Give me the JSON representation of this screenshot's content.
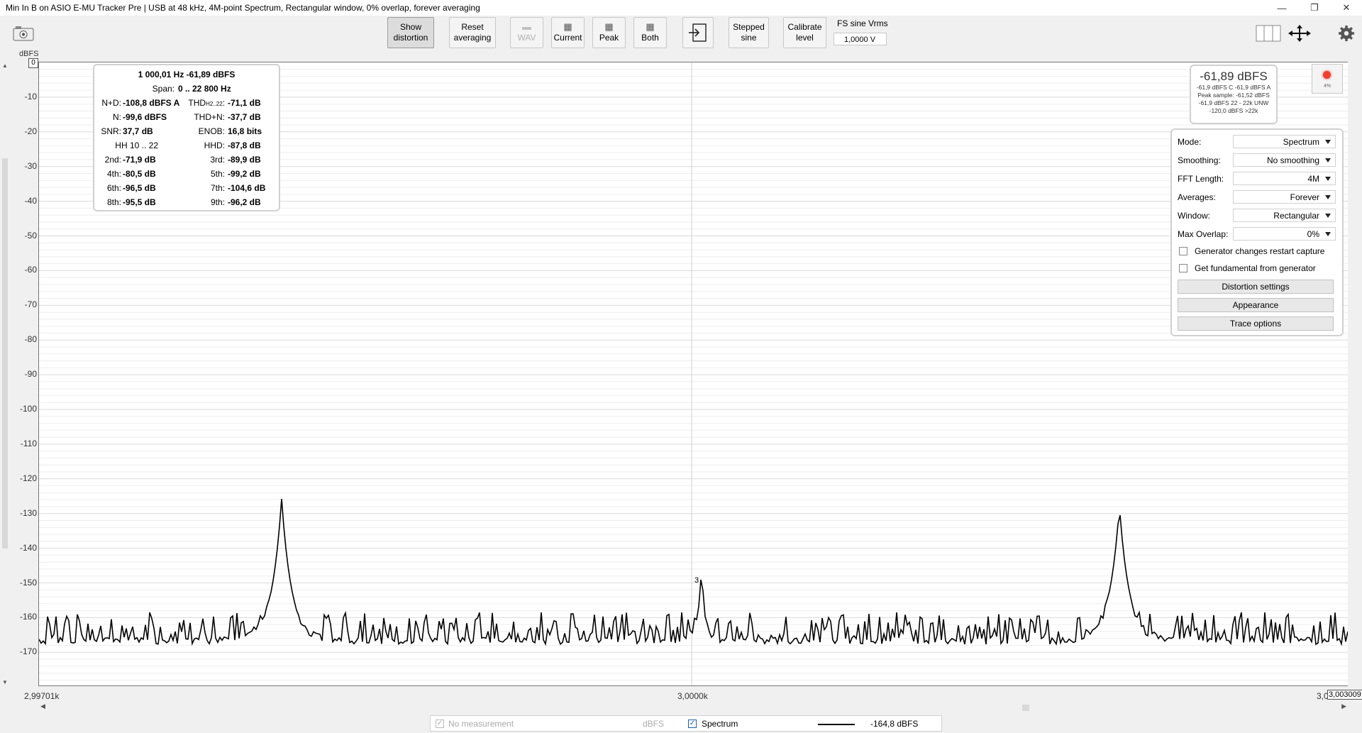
{
  "window": {
    "title": "Min In B on ASIO E-MU Tracker Pre | USB at 48 kHz, 4M-point Spectrum, Rectangular window, 0% overlap, forever averaging",
    "min_icon": "—",
    "restore_icon": "❐",
    "close_icon": "✕"
  },
  "toolbar": {
    "show_distortion": [
      "Show",
      "distortion"
    ],
    "reset_averaging": [
      "Reset",
      "averaging"
    ],
    "wav": "WAV",
    "current": "Current",
    "peak": "Peak",
    "both": "Both",
    "stepped_sine": [
      "Stepped",
      "sine"
    ],
    "calibrate_level": [
      "Calibrate",
      "level"
    ],
    "fs_label": "FS sine Vrms",
    "fs_value": "1,0000 V"
  },
  "graph": {
    "y_unit": "dBFS",
    "y_top_box": "0",
    "y_ticks": [
      "-10",
      "-20",
      "-30",
      "-40",
      "-50",
      "-60",
      "-70",
      "-80",
      "-90",
      "-100",
      "-110",
      "-120",
      "-130",
      "-140",
      "-150",
      "-160",
      "-170"
    ],
    "x_ticks": [
      "2,99701k",
      "3,0000k",
      "3,0"
    ],
    "x_cursor_box": "3,003009",
    "peak_marker": "3"
  },
  "info": {
    "header": "1 000,01 Hz  -61,89 dBFS",
    "span_label": "Span:",
    "span_value": "0 .. 22 800 Hz",
    "nd_label": "N+D:",
    "nd_value": "-108,8 dBFS A",
    "thd_label": "THD",
    "thd_sub": "H2..22",
    "thd_colon": ":",
    "thd_value": "-71,1 dB",
    "n_label": "N:",
    "n_value": "-99,6 dBFS",
    "thdn_label": "THD+N:",
    "thdn_value": "-37,7 dB",
    "snr_label": "SNR:",
    "snr_value": "37,7 dB",
    "enob_label": "ENOB:",
    "enob_value": "16,8 bits",
    "hh_label": "HH 10 .. 22",
    "hhd_label": "HHD:",
    "hhd_value": "-87,8 dB",
    "h2_label": "2nd:",
    "h2_value": "-71,9 dB",
    "h3_label": "3rd:",
    "h3_value": "-89,9 dB",
    "h4_label": "4th:",
    "h4_value": "-80,5 dB",
    "h5_label": "5th:",
    "h5_value": "-99,2 dB",
    "h6_label": "6th:",
    "h6_value": "-96,5 dB",
    "h7_label": "7th:",
    "h7_value": "-104,6 dB",
    "h8_label": "8th:",
    "h8_value": "-95,5 dB",
    "h9_label": "9th:",
    "h9_value": "-96,2 dB"
  },
  "level": {
    "main": "-61,89 dBFS",
    "line1": "-61,9 dBFS C  -61,9 dBFS A",
    "line2": "Peak sample: -61,52 dBFS",
    "line3": "-61,9 dBFS 22 - 22k UNW",
    "line4": "-120,0 dBFS >22k",
    "rec_pct": "4%"
  },
  "panel": {
    "mode_label": "Mode:",
    "mode_value": "Spectrum",
    "smoothing_label": "Smoothing:",
    "smoothing_value": "No smoothing",
    "fft_label": "FFT Length:",
    "fft_value": "4M",
    "averages_label": "Averages:",
    "averages_value": "Forever",
    "window_label": "Window:",
    "window_value": "Rectangular",
    "overlap_label": "Max Overlap:",
    "overlap_value": "0%",
    "gen_restart": "Generator changes restart capture",
    "gen_fundamental": "Get fundamental from generator",
    "distortion_settings": "Distortion settings",
    "appearance": "Appearance",
    "trace_options": "Trace options"
  },
  "legend": {
    "no_measurement": "No measurement",
    "unit": "dBFS",
    "spectrum": "Spectrum",
    "value": "-164,8 dBFS"
  },
  "colors": {
    "trace": "#000000",
    "grid": "#e6e6e6",
    "record": "#f04030"
  }
}
